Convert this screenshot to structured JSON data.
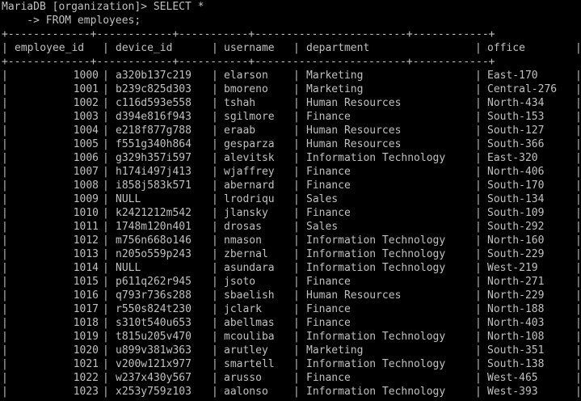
{
  "terminal": {
    "prompt_line": "MariaDB [organization]> SELECT *",
    "continuation_line": "    -> FROM employees;",
    "border_line": "+-------------+------------+-----------+------------------------+------------+"
  },
  "table": {
    "columns": [
      "employee_id",
      "device_id",
      "username",
      "department",
      "office"
    ],
    "rows": [
      [
        "1000",
        "a320b137c219",
        "elarson",
        "Marketing",
        "East-170"
      ],
      [
        "1001",
        "b239c825d303",
        "bmoreno",
        "Marketing",
        "Central-276"
      ],
      [
        "1002",
        "c116d593e558",
        "tshah",
        "Human Resources",
        "North-434"
      ],
      [
        "1003",
        "d394e816f943",
        "sgilmore",
        "Finance",
        "South-153"
      ],
      [
        "1004",
        "e218f877g788",
        "eraab",
        "Human Resources",
        "South-127"
      ],
      [
        "1005",
        "f551g340h864",
        "gesparza",
        "Human Resources",
        "South-366"
      ],
      [
        "1006",
        "g329h357i597",
        "alevitsk",
        "Information Technology",
        "East-320"
      ],
      [
        "1007",
        "h174i497j413",
        "wjaffrey",
        "Finance",
        "North-406"
      ],
      [
        "1008",
        "i858j583k571",
        "abernard",
        "Finance",
        "South-170"
      ],
      [
        "1009",
        "NULL",
        "lrodriqu",
        "Sales",
        "South-134"
      ],
      [
        "1010",
        "k2421212m542",
        "jlansky",
        "Finance",
        "South-109"
      ],
      [
        "1011",
        "1748m120n401",
        "drosas",
        "Sales",
        "South-292"
      ],
      [
        "1012",
        "m756n668o146",
        "nmason",
        "Information Technology",
        "North-160"
      ],
      [
        "1013",
        "n205o559p243",
        "zbernal",
        "Information Technology",
        "South-229"
      ],
      [
        "1014",
        "NULL",
        "asundara",
        "Information Technology",
        "West-219"
      ],
      [
        "1015",
        "p611q262r945",
        "jsoto",
        "Finance",
        "North-271"
      ],
      [
        "1016",
        "q793r736s288",
        "sbaelish",
        "Human Resources",
        "North-229"
      ],
      [
        "1017",
        "r550s824t230",
        "jclark",
        "Finance",
        "North-188"
      ],
      [
        "1018",
        "s310t540u653",
        "abellmas",
        "Finance",
        "North-403"
      ],
      [
        "1019",
        "t815u205v470",
        "mcouliba",
        "Information Technology",
        "North-108"
      ],
      [
        "1020",
        "u899v381w363",
        "arutley",
        "Marketing",
        "South-351"
      ],
      [
        "1021",
        "v200w121x977",
        "smartell",
        "Information Technology",
        "South-138"
      ],
      [
        "1022",
        "w237x430y567",
        "arusso",
        "Finance",
        "West-465"
      ],
      [
        "1023",
        "x253y759z103",
        "aalonso",
        "Information Technology",
        "West-393"
      ]
    ]
  },
  "colors": {
    "background": "#000000",
    "text": "#c0c0c0"
  }
}
